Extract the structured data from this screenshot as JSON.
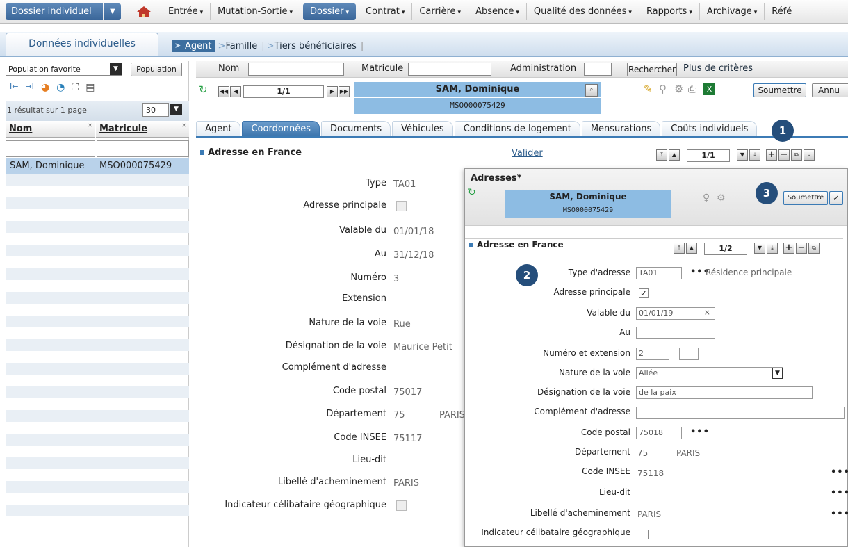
{
  "topnav": {
    "dossier_label": "Dossier individuel",
    "menu": [
      {
        "label": "Entrée",
        "active": false
      },
      {
        "label": "Mutation-Sortie",
        "active": false
      },
      {
        "label": "Dossier",
        "active": true
      },
      {
        "label": "Contrat",
        "active": false
      },
      {
        "label": "Carrière",
        "active": false
      },
      {
        "label": "Absence",
        "active": false
      },
      {
        "label": "Qualité des données",
        "active": false
      },
      {
        "label": "Rapports",
        "active": false
      },
      {
        "label": "Archivage",
        "active": false
      },
      {
        "label": "Réfé",
        "active": false
      }
    ]
  },
  "subheader": {
    "tab_label": "Données individuelles",
    "crumbs": [
      "Agent",
      "Famille",
      "Tiers bénéficiaires"
    ]
  },
  "leftpanel": {
    "population_select": "Population favorite",
    "population_button": "Population",
    "result_text": "1 résultat sur 1 page",
    "page_size": "30",
    "col_nom": "Nom",
    "col_matricule": "Matricule",
    "rows": [
      {
        "nom": "SAM, Dominique",
        "matricule": "MSO000075429"
      }
    ]
  },
  "search": {
    "nom_label": "Nom",
    "matricule_label": "Matricule",
    "administration_label": "Administration",
    "search_button": "Rechercher",
    "more_link": "Plus de critères"
  },
  "record": {
    "pager": "1/1",
    "name": "SAM, Dominique",
    "matricule": "MSO000075429",
    "submit_button": "Soumettre",
    "cancel_button": "Annu"
  },
  "tabs": [
    "Agent",
    "Coordonnées",
    "Documents",
    "Véhicules",
    "Conditions de logement",
    "Mensurations",
    "Coûts individuels"
  ],
  "section": {
    "title": "Adresse en France",
    "validate_link": "Valider",
    "pager": "1/1"
  },
  "form": {
    "fields": [
      {
        "label": "Type",
        "value": "TA01"
      },
      {
        "label": "Adresse principale",
        "value": ""
      },
      {
        "label": "Valable du",
        "value": "01/01/18"
      },
      {
        "label": "Au",
        "value": "31/12/18"
      },
      {
        "label": "Numéro",
        "value": "3"
      },
      {
        "label": "Extension",
        "value": ""
      },
      {
        "label": "Nature de la voie",
        "value": "Rue"
      },
      {
        "label": "Désignation de la voie",
        "value": "Maurice Petit"
      },
      {
        "label": "Complément d'adresse",
        "value": ""
      },
      {
        "label": "Code postal",
        "value": "75017"
      },
      {
        "label": "Département",
        "value": "75"
      },
      {
        "label": "Code INSEE",
        "value": "75117"
      },
      {
        "label": "Lieu-dit",
        "value": ""
      },
      {
        "label": "Libellé d'acheminement",
        "value": "PARIS"
      },
      {
        "label": "Indicateur célibataire géographique",
        "value": ""
      }
    ],
    "department_name": "PARIS"
  },
  "popup": {
    "title": "Adresses*",
    "name": "SAM, Dominique",
    "matricule": "MSO000075429",
    "submit_button": "Soumettre",
    "section_title": "Adresse en France",
    "pager": "1/2",
    "type_label": "Type d'adresse",
    "type_value": "TA01",
    "type_desc": "Résidence principale",
    "principale_label": "Adresse principale",
    "valable_label": "Valable du",
    "valable_value": "01/01/19",
    "au_label": "Au",
    "numero_label": "Numéro et extension",
    "numero_value": "2",
    "nature_label": "Nature de la voie",
    "nature_value": "Allée",
    "designation_label": "Désignation de la voie",
    "designation_value": "de la paix",
    "complement_label": "Complément d'adresse",
    "cp_label": "Code postal",
    "cp_value": "75018",
    "dept_label": "Département",
    "dept_value": "75",
    "dept_name": "PARIS",
    "insee_label": "Code INSEE",
    "insee_value": "75118",
    "lieudit_label": "Lieu-dit",
    "libelle_label": "Libellé d'acheminement",
    "libelle_value": "PARIS",
    "celib_label": "Indicateur célibataire géographique"
  },
  "badges": [
    "1",
    "2",
    "3"
  ],
  "ellipsis": "•••",
  "colors": {
    "accent": "#3c6e9f",
    "name_box": "#8dbce3",
    "badge": "#254e7b"
  }
}
